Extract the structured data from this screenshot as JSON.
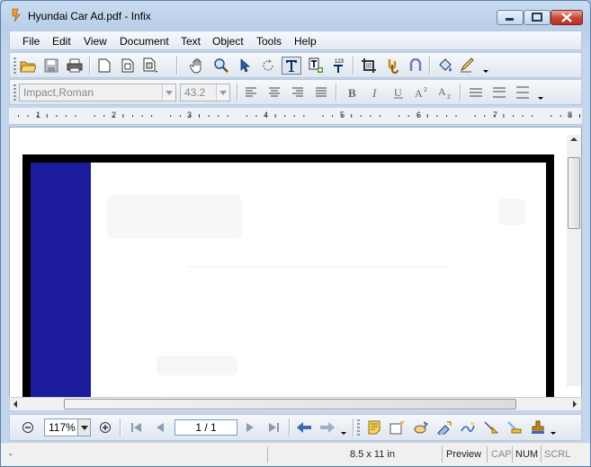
{
  "window": {
    "title": "Hyundai Car Ad.pdf - Infix"
  },
  "menu": [
    "File",
    "Edit",
    "View",
    "Document",
    "Text",
    "Object",
    "Tools",
    "Help"
  ],
  "toolbar_font": {
    "font_name": "Impact,Roman",
    "font_size": "43.2"
  },
  "ruler": {
    "numbers": [
      "1",
      "2",
      "3",
      "4",
      "5",
      "6",
      "7",
      "8"
    ]
  },
  "navigation": {
    "zoom": "117%",
    "page": "1 / 1"
  },
  "status": {
    "left": "-",
    "page_size": "8.5 x 11 in",
    "mode": "Preview",
    "cap": "CAP",
    "num": "NUM",
    "scrl": "SCRL"
  },
  "colors": {
    "page_border": "#000000",
    "blue_band": "#1b1b9c",
    "accent": "#5c7ea6"
  }
}
